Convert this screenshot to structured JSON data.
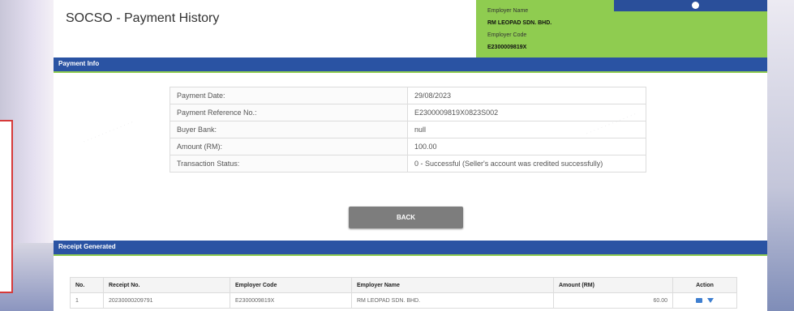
{
  "page_title": "SOCSO - Payment History",
  "employer": {
    "name_label": "Employer Name",
    "name_value": "RM LEOPAD SDN. BHD.",
    "code_label": "Employer Code",
    "code_value": "E2300009819X"
  },
  "payment_info": {
    "section_title": "Payment Info",
    "rows": [
      {
        "label": "Payment Date:",
        "value": "29/08/2023"
      },
      {
        "label": "Payment Reference No.:",
        "value": "E2300009819X0823S002"
      },
      {
        "label": "Buyer Bank:",
        "value": "null"
      },
      {
        "label": "Amount (RM):",
        "value": "100.00"
      },
      {
        "label": "Transaction Status:",
        "value": "0 - Successful (Seller's account was credited successfully)"
      }
    ],
    "back_label": "BACK"
  },
  "receipt": {
    "section_title": "Receipt Generated",
    "columns": [
      "No.",
      "Receipt No.",
      "Employer Code",
      "Employer Name",
      "Amount (RM)",
      "Action"
    ],
    "rows": [
      {
        "no": "1",
        "receipt_no": "20230000209791",
        "employer_code": "E2300009819X",
        "employer_name": "RM LEOPAD SDN. BHD.",
        "amount": "60.00",
        "actions": [
          "mail-icon",
          "download-icon"
        ]
      }
    ]
  },
  "colors": {
    "section_bar": "#2a53a3",
    "employer_box": "#8fcc50",
    "back_button": "#7d7d7d",
    "action_icon": "#3f7fd0"
  }
}
